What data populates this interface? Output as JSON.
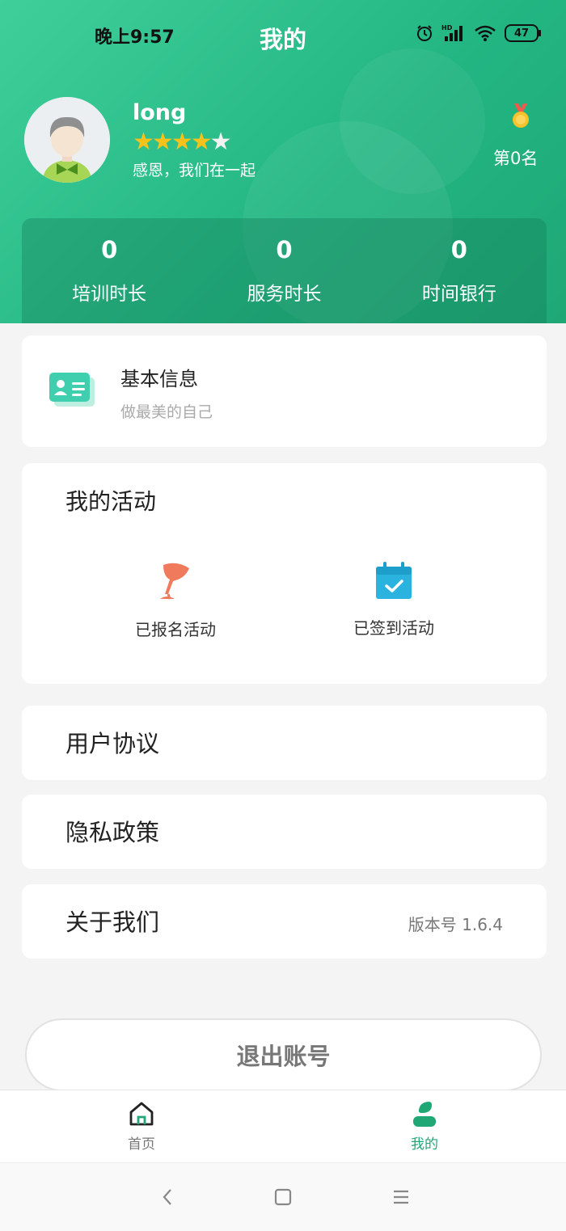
{
  "status_bar": {
    "time": "晚上9:57",
    "signal_label": "HD",
    "battery": "47"
  },
  "page_title": "我的",
  "profile": {
    "name": "long",
    "rating": 4,
    "rating_max": 5,
    "motto": "感恩，我们在一起",
    "rank": "第0名"
  },
  "stats": [
    {
      "value": "0",
      "label": "培训时长"
    },
    {
      "value": "0",
      "label": "服务时长"
    },
    {
      "value": "0",
      "label": "时间银行"
    }
  ],
  "basic_info": {
    "title": "基本信息",
    "subtitle": "做最美的自己"
  },
  "activities": {
    "title": "我的活动",
    "items": [
      {
        "label": "已报名活动",
        "icon": "flag-icon"
      },
      {
        "label": "已签到活动",
        "icon": "calendar-check-icon"
      }
    ]
  },
  "menu": [
    {
      "label": "用户协议",
      "value": ""
    },
    {
      "label": "隐私政策",
      "value": ""
    },
    {
      "label": "关于我们",
      "value": "版本号 1.6.4"
    }
  ],
  "logout_label": "退出账号",
  "tabbar": [
    {
      "label": "首页",
      "icon": "home-icon",
      "active": false
    },
    {
      "label": "我的",
      "icon": "user-icon",
      "active": true
    }
  ],
  "colors": {
    "brand": "#22b582",
    "star": "#f8c21b",
    "flag": "#ef7a5c",
    "calendar": "#2bb3e0"
  }
}
